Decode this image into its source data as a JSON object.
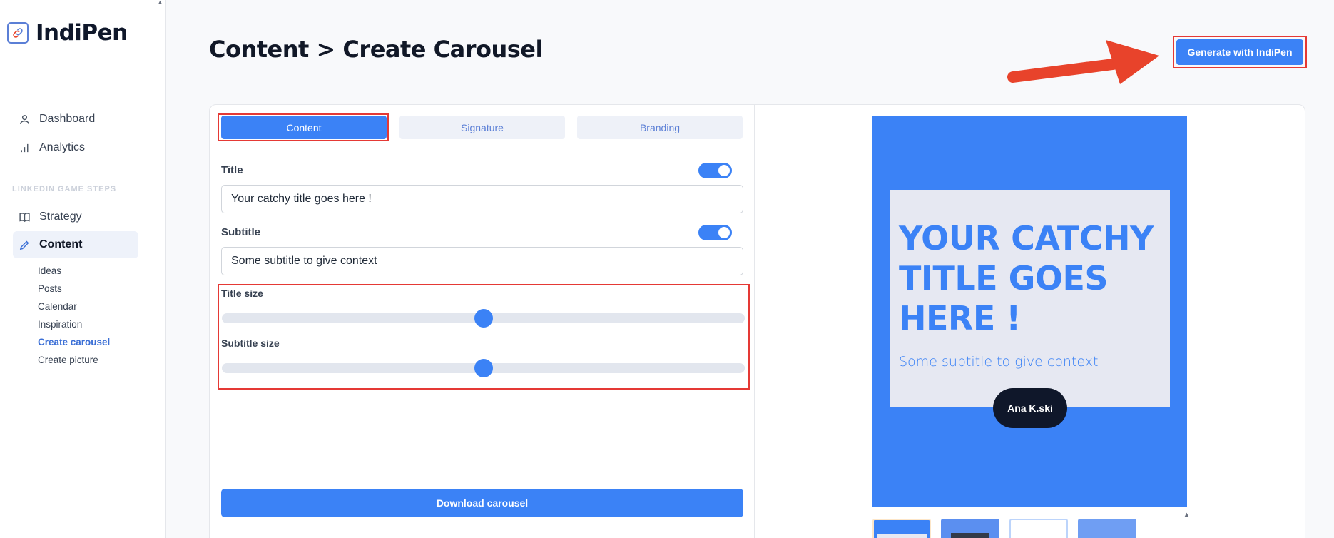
{
  "app": {
    "name": "IndiPen",
    "logo_icon": "link-icon"
  },
  "sidebar": {
    "main_items": [
      {
        "label": "Dashboard",
        "icon": "user-icon"
      },
      {
        "label": "Analytics",
        "icon": "bar-chart-icon"
      }
    ],
    "section_label": "LINKEDIN GAME STEPS",
    "steps": [
      {
        "label": "Strategy",
        "icon": "book-icon"
      },
      {
        "label": "Content",
        "icon": "pencil-icon",
        "active": true
      }
    ],
    "sub_items": [
      {
        "label": "Ideas"
      },
      {
        "label": "Posts"
      },
      {
        "label": "Calendar"
      },
      {
        "label": "Inspiration"
      },
      {
        "label": "Create carousel",
        "active": true
      },
      {
        "label": "Create picture"
      }
    ]
  },
  "header": {
    "title": "Content > Create Carousel",
    "generate_label": "Generate with IndiPen"
  },
  "tabs": [
    {
      "label": "Content",
      "active": true
    },
    {
      "label": "Signature"
    },
    {
      "label": "Branding"
    }
  ],
  "form": {
    "title_label": "Title",
    "title_value": "Your catchy title goes here !",
    "title_enabled": true,
    "subtitle_label": "Subtitle",
    "subtitle_value": "Some subtitle to give context",
    "subtitle_enabled": true,
    "title_size_label": "Title size",
    "title_size_fraction": 0.5,
    "subtitle_size_label": "Subtitle size",
    "subtitle_size_fraction": 0.5,
    "download_label": "Download carousel"
  },
  "preview": {
    "title": "Your catchy title goes here !",
    "subtitle": "Some subtitle to give context",
    "author": "Ana K.ski"
  },
  "colors": {
    "accent": "#3b82f6",
    "highlight": "#e53935",
    "arrow": "#e8432b",
    "dark": "#0f172a"
  }
}
